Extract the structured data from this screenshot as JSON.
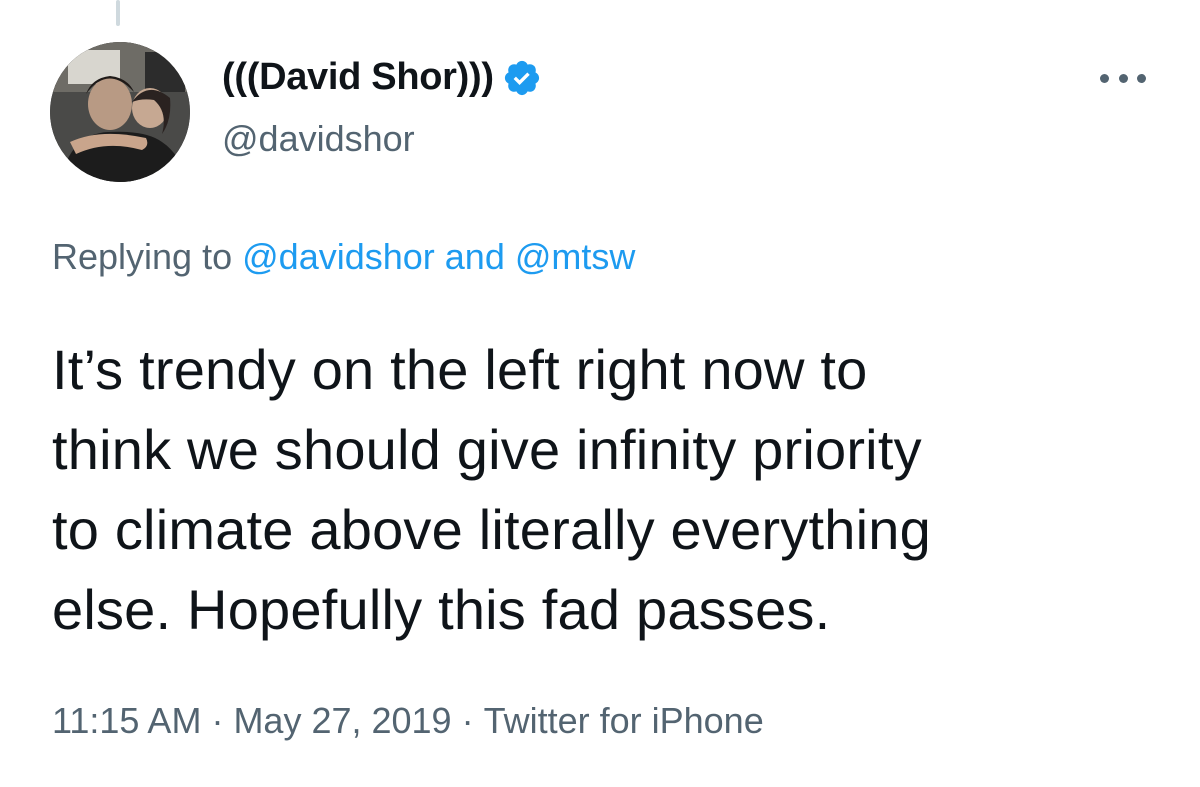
{
  "tweet": {
    "author": {
      "display_name": "(((David Shor)))",
      "handle": "@davidshor",
      "verified": true,
      "verified_icon": "verified-badge-icon",
      "avatar_icon": "profile-photo"
    },
    "more_icon": "more-options-icon",
    "reply": {
      "prefix": "Replying to",
      "mention_1": "@davidshor",
      "conjunction": "and",
      "mention_2": "@mtsw"
    },
    "body_lines": [
      "It’s trendy on the left right now to",
      "think we should give infinity priority",
      "to climate above literally everything",
      "else. Hopefully this fad passes."
    ],
    "meta": {
      "time": "11:15 AM",
      "separator": "·",
      "date": "May 27, 2019",
      "source": "Twitter for iPhone"
    }
  },
  "colors": {
    "text": "#0f1419",
    "secondary": "#536471",
    "link": "#1d9bf0",
    "verified": "#1d9bf0",
    "thread_line": "#cfd9de"
  }
}
